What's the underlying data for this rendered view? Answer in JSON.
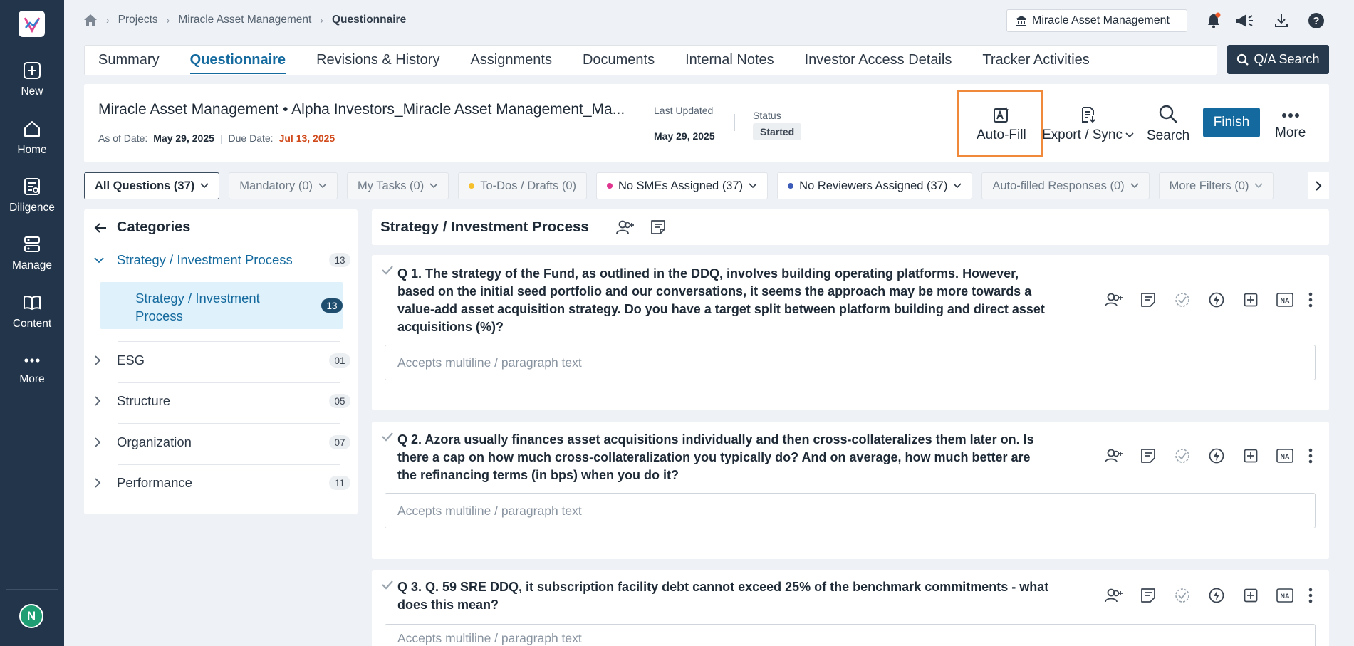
{
  "rail": {
    "items": [
      {
        "label": "New",
        "icon": "plus-square-icon"
      },
      {
        "label": "Home",
        "icon": "home-icon"
      },
      {
        "label": "Diligence",
        "icon": "diligence-icon"
      },
      {
        "label": "Manage",
        "icon": "manage-icon"
      },
      {
        "label": "Content",
        "icon": "book-icon"
      },
      {
        "label": "More",
        "icon": "more-dots-icon"
      }
    ],
    "avatar_initial": "N"
  },
  "breadcrumb": [
    "Projects",
    "Miracle Asset Management",
    "Questionnaire"
  ],
  "firm_chip": "Miracle Asset Management",
  "tabs": [
    "Summary",
    "Questionnaire",
    "Revisions & History",
    "Assignments",
    "Documents",
    "Internal Notes",
    "Investor Access Details",
    "Tracker Activities"
  ],
  "active_tab": "Questionnaire",
  "qa_search_label": "Q/A Search",
  "header": {
    "title": "Miracle Asset Management • Alpha Investors_Miracle Asset Management_Ma...",
    "as_of_label": "As of Date:",
    "as_of_value": "May 29, 2025",
    "due_label": "Due Date:",
    "due_value": "Jul 13, 2025",
    "last_updated_label": "Last Updated",
    "last_updated_value": "May 29, 2025",
    "status_label": "Status",
    "status_value": "Started",
    "actions": {
      "autofill": "Auto-Fill",
      "export": "Export / Sync",
      "search": "Search",
      "finish": "Finish",
      "more": "More"
    }
  },
  "filters": [
    {
      "label": "All Questions (37)",
      "dot": null
    },
    {
      "label": "Mandatory (0)",
      "dot": null
    },
    {
      "label": "My Tasks (0)",
      "dot": null
    },
    {
      "label": "To-Dos / Drafts (0)",
      "dot": "#f5c02b"
    },
    {
      "label": "No SMEs Assigned (37)",
      "dot": "#e0358f"
    },
    {
      "label": "No Reviewers Assigned (37)",
      "dot": "#3d5bb8"
    },
    {
      "label": "Auto-filled Responses (0)",
      "dot": null
    },
    {
      "label": "More Filters (0)",
      "dot": null
    }
  ],
  "categories": {
    "heading": "Categories",
    "items": [
      {
        "name": "Strategy / Investment Process",
        "count": "13",
        "open": true
      },
      {
        "name": "ESG",
        "count": "01"
      },
      {
        "name": "Structure",
        "count": "05"
      },
      {
        "name": "Organization",
        "count": "07"
      },
      {
        "name": "Performance",
        "count": "11"
      }
    ],
    "sub": {
      "name": "Strategy / Investment Process",
      "count": "13"
    }
  },
  "section_title": "Strategy / Investment Process",
  "answer_placeholder": "Accepts multiline / paragraph text",
  "questions": [
    {
      "text": "Q 1. The strategy of the Fund, as outlined in the DDQ, involves building operating platforms. However, based on the initial seed portfolio and our conversations, it seems the approach may be more towards a value-add asset acquisition strategy. Do you have a target split between platform building and direct asset acquisitions (%)?"
    },
    {
      "text": "Q 2. Azora usually finances asset acquisitions individually and then cross-collateralizes them later on. Is there a cap on how much cross-collateralization you typically do? And on average, how much better are the refinancing terms (in bps) when you do it?"
    },
    {
      "text": "Q 3. Q. 59 SRE DDQ, it subscription facility debt cannot exceed 25% of the benchmark commitments - what does this mean?"
    }
  ],
  "colors": {
    "rail": "#22354a",
    "accent": "#146a9e",
    "highlight": "#f08a3a",
    "due": "#d04a1b"
  }
}
